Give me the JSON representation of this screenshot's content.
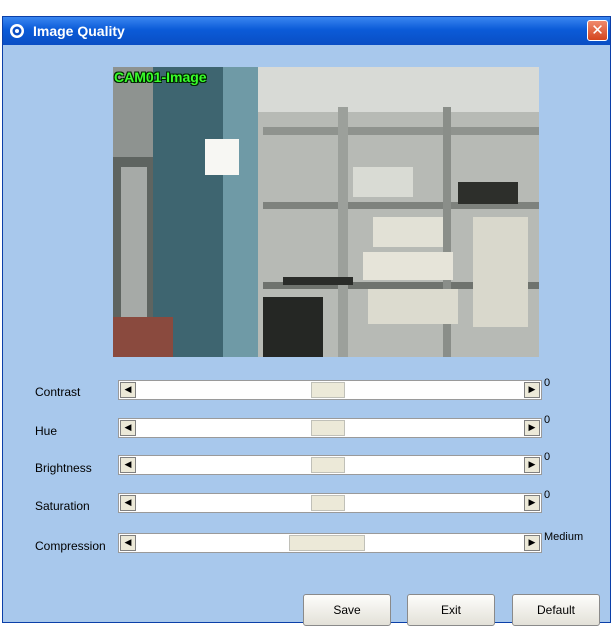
{
  "window": {
    "title": "Image Quality"
  },
  "video": {
    "label": "CAM01-Image"
  },
  "controls": [
    {
      "label": "Contrast",
      "value": "0",
      "level": 0.5
    },
    {
      "label": "Hue",
      "value": "0",
      "level": 0.5
    },
    {
      "label": "Brightness",
      "value": "0",
      "level": 0.5
    },
    {
      "label": "Saturation",
      "value": "0",
      "level": 0.5
    },
    {
      "label": "Compression",
      "value": "Medium",
      "level": 0.5
    }
  ],
  "buttons": {
    "save": "Save",
    "exit": "Exit",
    "default": "Default"
  },
  "colors": {
    "titlebar": "#0b5bd8",
    "window_bg": "#a8c8ec",
    "overlay_text": "#39ff2a"
  }
}
